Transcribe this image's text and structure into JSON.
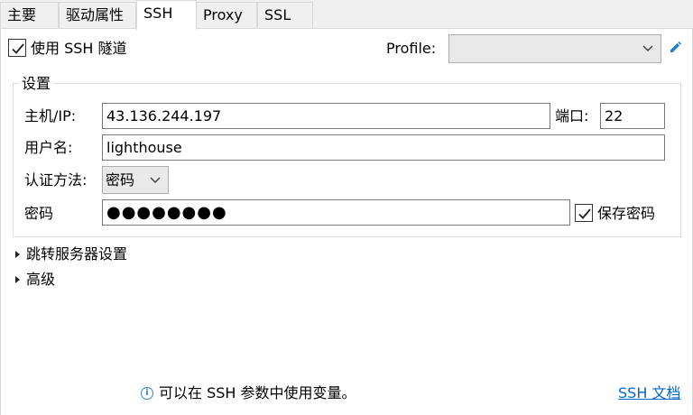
{
  "tabs": [
    {
      "label": "主要"
    },
    {
      "label": "驱动属性"
    },
    {
      "label": "SSH"
    },
    {
      "label": "Proxy"
    },
    {
      "label": "SSL"
    }
  ],
  "use_ssh_tunnel": {
    "label": "使用 SSH 隧道",
    "checked": true
  },
  "profile": {
    "label": "Profile:",
    "value": ""
  },
  "settings": {
    "title": "设置",
    "host_label": "主机/IP:",
    "host_value": "43.136.244.197",
    "port_label": "端口:",
    "port_value": "22",
    "username_label": "用户名:",
    "username_value": "lighthouse",
    "auth_label": "认证方法:",
    "auth_value": "密码",
    "password_label": "密码",
    "password_value": "●●●●●●●●",
    "save_password_label": "保存密码",
    "save_password_checked": true
  },
  "jump_server": {
    "label": "跳转服务器设置"
  },
  "advanced": {
    "label": "高级"
  },
  "footer": {
    "info_text": "可以在 SSH 参数中使用变量。",
    "doc_link": "SSH 文档"
  },
  "colors": {
    "link": "#0066cc",
    "edit_icon": "#1a7fd6"
  }
}
